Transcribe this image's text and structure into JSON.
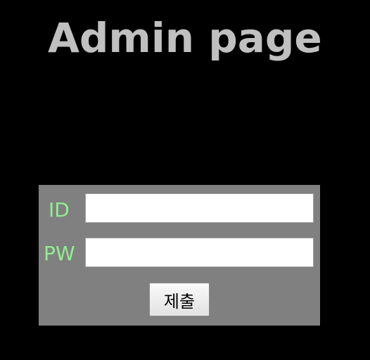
{
  "page": {
    "title": "Admin page"
  },
  "login_form": {
    "id_label": "ID",
    "id_value": "",
    "pw_label": "PW",
    "pw_value": "",
    "submit_label": "제출"
  },
  "colors": {
    "background": "#000000",
    "title": "#c0c0c0",
    "panel": "#808080",
    "label": "#90ee90"
  }
}
